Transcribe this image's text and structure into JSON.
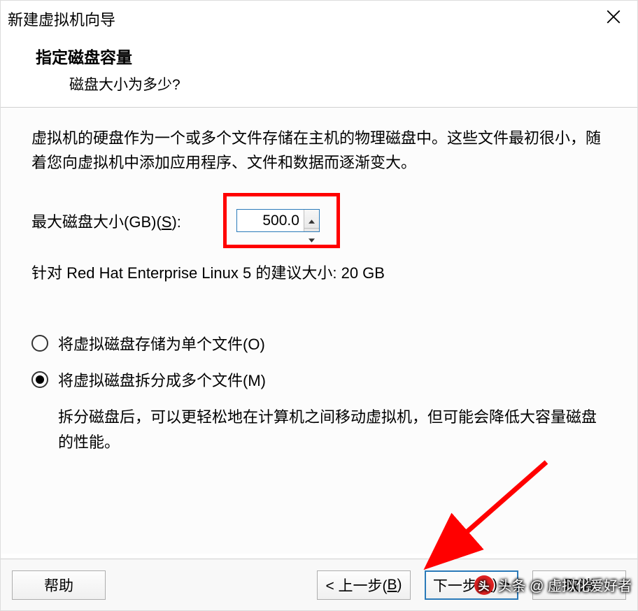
{
  "title": "新建虚拟机向导",
  "header": {
    "heading": "指定磁盘容量",
    "sub": "磁盘大小为多少?"
  },
  "description": "虚拟机的硬盘作为一个或多个文件存储在主机的物理磁盘中。这些文件最初很小，随着您向虚拟机中添加应用程序、文件和数据而逐渐变大。",
  "diskSize": {
    "labelPrefix": "最大磁盘大小(GB)(",
    "accel": "S",
    "labelSuffix": "):",
    "value": "500.0"
  },
  "recommend": "针对 Red Hat Enterprise Linux 5 的建议大小: 20 GB",
  "options": {
    "single": {
      "textPrefix": "将虚拟磁盘存储为单个文件(",
      "accel": "O",
      "textSuffix": ")"
    },
    "split": {
      "textPrefix": "将虚拟磁盘拆分成多个文件(",
      "accel": "M",
      "textSuffix": ")"
    },
    "splitDesc": "拆分磁盘后，可以更轻松地在计算机之间移动虚拟机，但可能会降低大容量磁盘的性能。"
  },
  "buttons": {
    "help": "帮助",
    "back": {
      "prefix": "< 上一步(",
      "accel": "B",
      "suffix": ")"
    },
    "next": {
      "prefix": "下一步(",
      "accel": "N",
      "suffix": ") >"
    },
    "cancel": "取消"
  },
  "watermark": "头条 @ 虚拟化爱好者"
}
